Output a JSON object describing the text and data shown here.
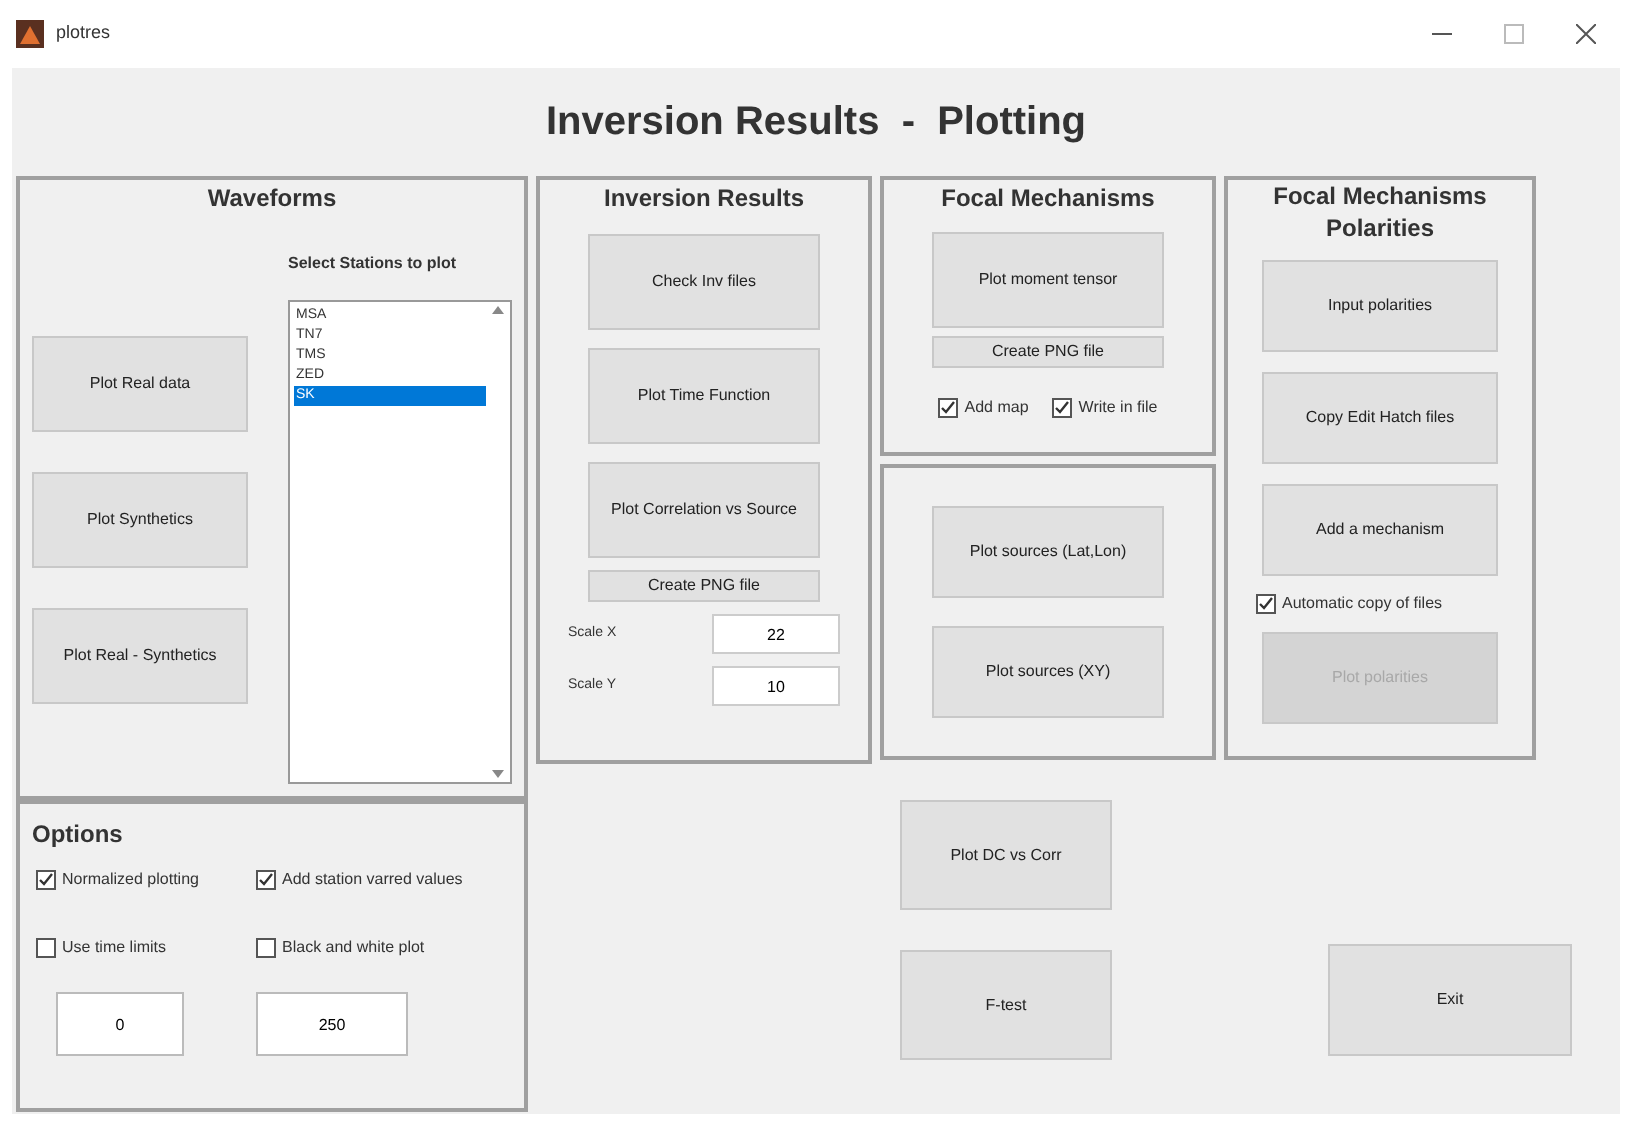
{
  "window": {
    "title": "plotres"
  },
  "heading": "Inversion Results  -  Plotting",
  "waveforms": {
    "title": "Waveforms",
    "buttons": [
      "Plot Real data",
      "Plot Synthetics",
      "Plot Real - Synthetics"
    ],
    "stations_label": "Select Stations to plot",
    "stations": [
      {
        "label": "MSA",
        "selected": false
      },
      {
        "label": "TN7",
        "selected": false
      },
      {
        "label": "TMS",
        "selected": false
      },
      {
        "label": "ZED",
        "selected": false
      },
      {
        "label": "SK",
        "selected": true
      }
    ]
  },
  "options": {
    "title": "Options",
    "checkboxes": [
      {
        "label": "Normalized plotting",
        "checked": true
      },
      {
        "label": "Add station varred values",
        "checked": true
      },
      {
        "label": "Use time limits",
        "checked": false
      },
      {
        "label": "Black and white plot",
        "checked": false
      }
    ],
    "fields": [
      "0",
      "250"
    ]
  },
  "inversion_results": {
    "title": "Inversion Results",
    "buttons": [
      "Check Inv files",
      "Plot Time Function",
      "Plot Correlation vs Source"
    ],
    "png_button": "Create PNG file",
    "scales": [
      {
        "label": "Scale X",
        "value": "22"
      },
      {
        "label": "Scale Y",
        "value": "10"
      }
    ]
  },
  "focal_mechanisms": {
    "title": "Focal Mechanisms",
    "button": "Plot moment tensor",
    "png_button": "Create PNG file",
    "checkboxes": [
      {
        "label": "Add map",
        "checked": true
      },
      {
        "label": "Write in file",
        "checked": true
      }
    ]
  },
  "sources": {
    "buttons": [
      "Plot sources (Lat,Lon)",
      "Plot sources (XY)"
    ]
  },
  "polarities": {
    "title": "Focal Mechanisms Polarities",
    "buttons": [
      "Input polarities",
      "Copy Edit Hatch files",
      "Add a mechanism"
    ],
    "checkbox": {
      "label": "Automatic copy of files",
      "checked": true
    },
    "plot_button": {
      "label": "Plot polarities",
      "disabled": true
    }
  },
  "bottom_buttons": [
    "Plot DC vs Corr",
    "F-test"
  ],
  "exit_button": "Exit"
}
